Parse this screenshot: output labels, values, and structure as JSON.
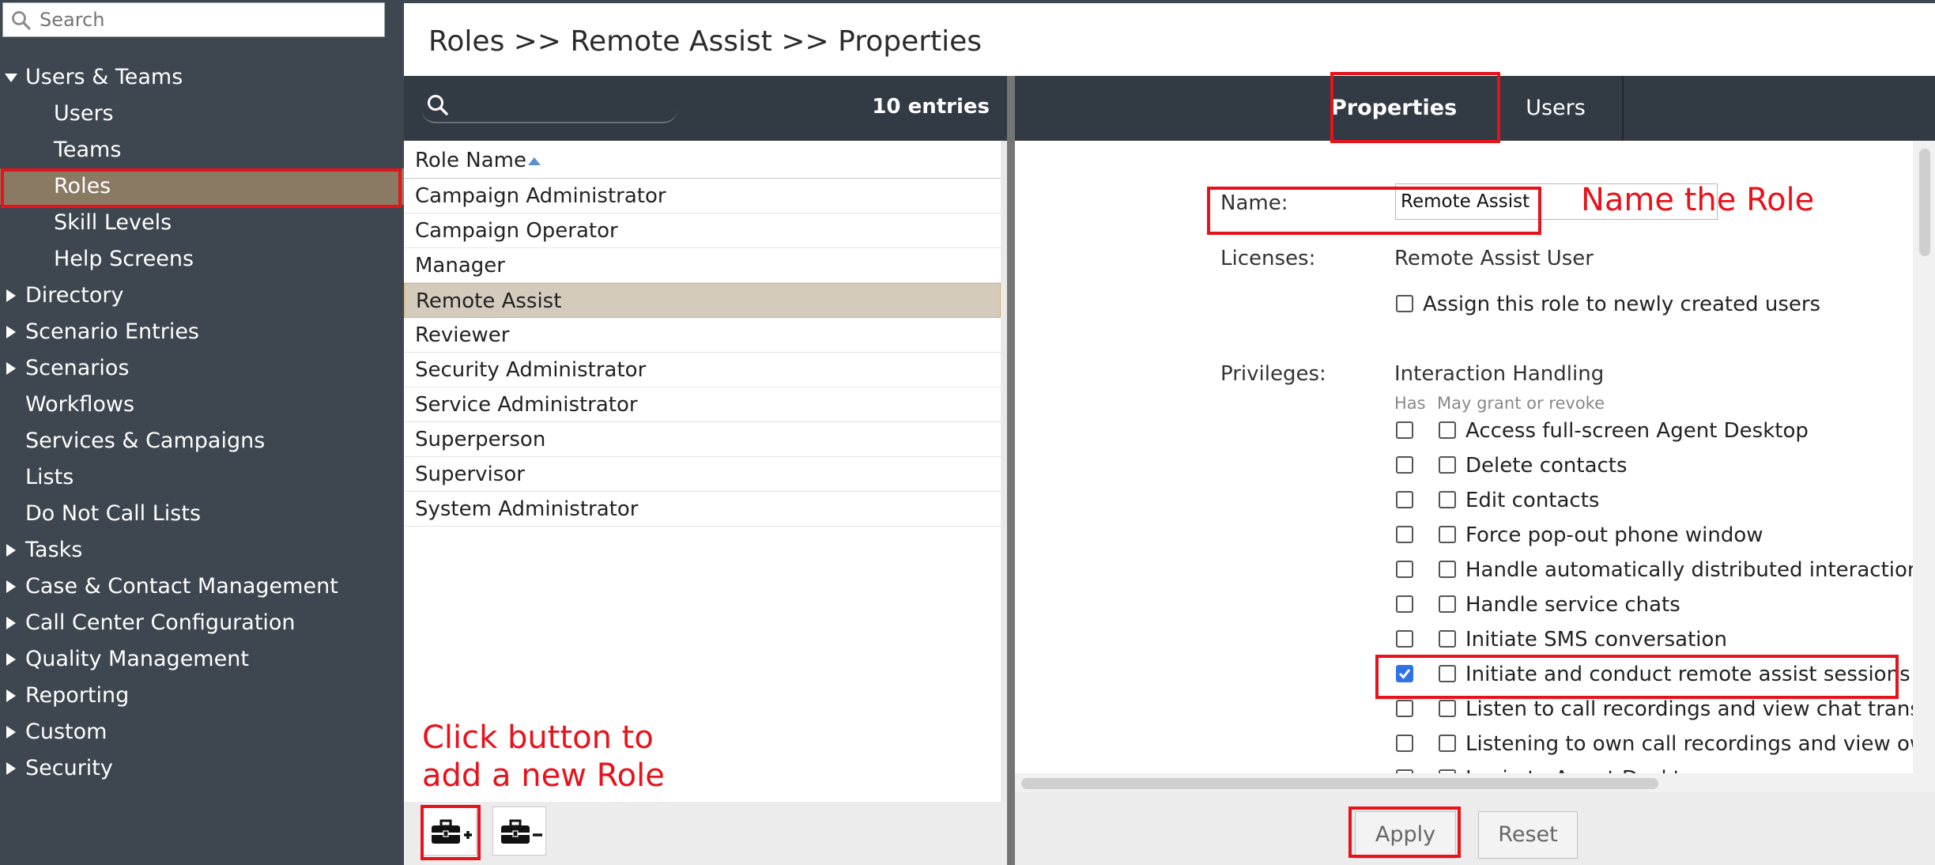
{
  "sidebar": {
    "search_placeholder": "Search",
    "items": [
      {
        "label": "Users & Teams",
        "type": "expanded"
      },
      {
        "label": "Users",
        "type": "child"
      },
      {
        "label": "Teams",
        "type": "child"
      },
      {
        "label": "Roles",
        "type": "child",
        "selected": true
      },
      {
        "label": "Skill Levels",
        "type": "child"
      },
      {
        "label": "Help Screens",
        "type": "child"
      },
      {
        "label": "Directory",
        "type": "collapsed"
      },
      {
        "label": "Scenario Entries",
        "type": "collapsed"
      },
      {
        "label": "Scenarios",
        "type": "collapsed"
      },
      {
        "label": "Workflows",
        "type": "leaf"
      },
      {
        "label": "Services & Campaigns",
        "type": "leaf"
      },
      {
        "label": "Lists",
        "type": "leaf"
      },
      {
        "label": "Do Not Call Lists",
        "type": "leaf"
      },
      {
        "label": "Tasks",
        "type": "collapsed"
      },
      {
        "label": "Case & Contact Management",
        "type": "collapsed"
      },
      {
        "label": "Call Center Configuration",
        "type": "collapsed"
      },
      {
        "label": "Quality Management",
        "type": "collapsed"
      },
      {
        "label": "Reporting",
        "type": "collapsed"
      },
      {
        "label": "Custom",
        "type": "collapsed"
      },
      {
        "label": "Security",
        "type": "collapsed"
      }
    ]
  },
  "header": {
    "title": "Roles >> Remote Assist >> Properties"
  },
  "list": {
    "entries": "10 entries",
    "column": "Role Name",
    "rows": [
      "Campaign Administrator",
      "Campaign Operator",
      "Manager",
      "Remote Assist",
      "Reviewer",
      "Security Administrator",
      "Service Administrator",
      "Superperson",
      "Supervisor",
      "System Administrator"
    ],
    "selected_row": "Remote Assist"
  },
  "tabs": {
    "properties": "Properties",
    "users": "Users",
    "active": "Properties"
  },
  "form": {
    "name_label": "Name:",
    "name_value": "Remote Assist",
    "licenses_label": "Licenses:",
    "licenses_value": "Remote Assist User",
    "assign_label": "Assign this role to newly created users",
    "privileges_label": "Privileges:",
    "group": "Interaction Handling",
    "col_has": "Has",
    "col_grant": "May grant or revoke",
    "privileges": [
      {
        "label": "Access full-screen Agent Desktop",
        "has": false,
        "grant": false
      },
      {
        "label": "Delete contacts",
        "has": false,
        "grant": false
      },
      {
        "label": "Edit contacts",
        "has": false,
        "grant": false
      },
      {
        "label": "Force pop-out phone window",
        "has": false,
        "grant": false
      },
      {
        "label": "Handle automatically distributed interactions",
        "has": false,
        "grant": false
      },
      {
        "label": "Handle service chats",
        "has": false,
        "grant": false
      },
      {
        "label": "Initiate SMS conversation",
        "has": false,
        "grant": false
      },
      {
        "label": "Initiate and conduct remote assist sessions",
        "has": true,
        "grant": false
      },
      {
        "label": "Listen to call recordings and view chat transcri",
        "has": false,
        "grant": false
      },
      {
        "label": "Listening to own call recordings and view own",
        "has": false,
        "grant": false
      },
      {
        "label": "Login to Agent Desktop",
        "has": false,
        "grant": false
      }
    ]
  },
  "buttons": {
    "apply": "Apply",
    "reset": "Reset"
  },
  "annotations": {
    "name_the_role": "Name the Role",
    "add_role_line1": "Click button to",
    "add_role_line2": "add a new Role",
    "color": "#e8121b"
  },
  "icons": {
    "search": "search-icon",
    "add_role": "briefcase-plus-icon",
    "remove_role": "briefcase-minus-icon",
    "sort": "sort-ascending-icon"
  },
  "colors": {
    "sidebar_bg": "#3e464f",
    "sidebar_selected": "#8a7a64",
    "header_bg": "#323a43",
    "row_selected": "#d4cbbd",
    "checkbox_checked": "#2f73e6"
  }
}
